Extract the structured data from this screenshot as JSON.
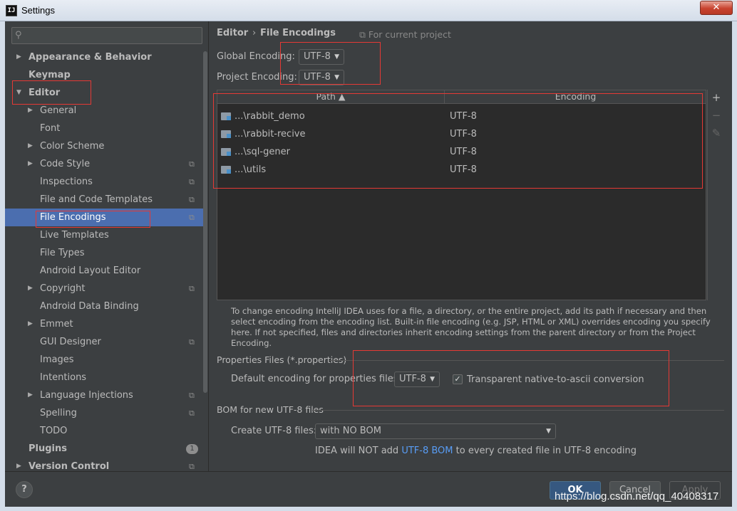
{
  "window": {
    "title": "Settings",
    "app_logo": "IJ",
    "close_glyph": "✕"
  },
  "sidebar": {
    "search_placeholder": "",
    "items": [
      {
        "label": "Appearance & Behavior",
        "level": 0,
        "expandable": true,
        "expanded": false,
        "bold": true
      },
      {
        "label": "Keymap",
        "level": 0,
        "bold": true
      },
      {
        "label": "Editor",
        "level": 0,
        "expandable": true,
        "expanded": true,
        "bold": true
      },
      {
        "label": "General",
        "level": 1,
        "expandable": true
      },
      {
        "label": "Font",
        "level": 1
      },
      {
        "label": "Color Scheme",
        "level": 1,
        "expandable": true
      },
      {
        "label": "Code Style",
        "level": 1,
        "expandable": true,
        "project_icon": true
      },
      {
        "label": "Inspections",
        "level": 1,
        "project_icon": true
      },
      {
        "label": "File and Code Templates",
        "level": 1,
        "project_icon": true
      },
      {
        "label": "File Encodings",
        "level": 1,
        "project_icon": true,
        "selected": true
      },
      {
        "label": "Live Templates",
        "level": 1
      },
      {
        "label": "File Types",
        "level": 1
      },
      {
        "label": "Android Layout Editor",
        "level": 1
      },
      {
        "label": "Copyright",
        "level": 1,
        "expandable": true,
        "project_icon": true
      },
      {
        "label": "Android Data Binding",
        "level": 1
      },
      {
        "label": "Emmet",
        "level": 1,
        "expandable": true
      },
      {
        "label": "GUI Designer",
        "level": 1,
        "project_icon": true
      },
      {
        "label": "Images",
        "level": 1
      },
      {
        "label": "Intentions",
        "level": 1
      },
      {
        "label": "Language Injections",
        "level": 1,
        "expandable": true,
        "project_icon": true
      },
      {
        "label": "Spelling",
        "level": 1,
        "project_icon": true
      },
      {
        "label": "TODO",
        "level": 1
      },
      {
        "label": "Plugins",
        "level": 0,
        "bold": true,
        "badge": "1"
      },
      {
        "label": "Version Control",
        "level": 0,
        "expandable": true,
        "bold": true,
        "project_icon": true
      }
    ]
  },
  "breadcrumb": {
    "parent": "Editor",
    "separator": "›",
    "current": "File Encodings"
  },
  "scope_note": "⧉ For current project",
  "global_encoding": {
    "label": "Global Encoding:",
    "value": "UTF-8"
  },
  "project_encoding": {
    "label": "Project Encoding:",
    "value": "UTF-8"
  },
  "table": {
    "columns": [
      "Path ▲",
      "Encoding"
    ],
    "rows": [
      {
        "path": "...\\rabbit_demo",
        "encoding": "UTF-8"
      },
      {
        "path": "...\\rabbit-recive",
        "encoding": "UTF-8"
      },
      {
        "path": "...\\sql-gener",
        "encoding": "UTF-8"
      },
      {
        "path": "...\\utils",
        "encoding": "UTF-8"
      }
    ],
    "tools": {
      "add": "+",
      "remove": "−",
      "edit": "✎"
    }
  },
  "help_text": "To change encoding IntelliJ IDEA uses for a file, a directory, or the entire project, add its path if necessary and then select encoding from the encoding list. Built-in file encoding (e.g. JSP, HTML or XML) overrides encoding you specify here. If not specified, files and directories inherit encoding settings from the parent directory or from the Project Encoding.",
  "properties": {
    "section_title": "Properties Files (*.properties)",
    "default_label": "Default encoding for properties files:",
    "default_value": "UTF-8",
    "transparent_checked": true,
    "transparent_label": "Transparent native-to-ascii conversion"
  },
  "bom": {
    "section_title": "BOM for new UTF-8 files",
    "create_label": "Create UTF-8 files:",
    "create_value": "with NO BOM",
    "note_prefix": "IDEA will NOT add ",
    "note_link": "UTF-8 BOM",
    "note_suffix": " to every created file in UTF-8 encoding"
  },
  "footer": {
    "help": "?",
    "ok": "OK",
    "cancel": "Cancel",
    "apply": "Apply"
  },
  "watermark": "https://blog.csdn.net/qq_40408317",
  "colors": {
    "accent": "#4b6eaf",
    "annotation": "#e53935",
    "link": "#589df6"
  }
}
